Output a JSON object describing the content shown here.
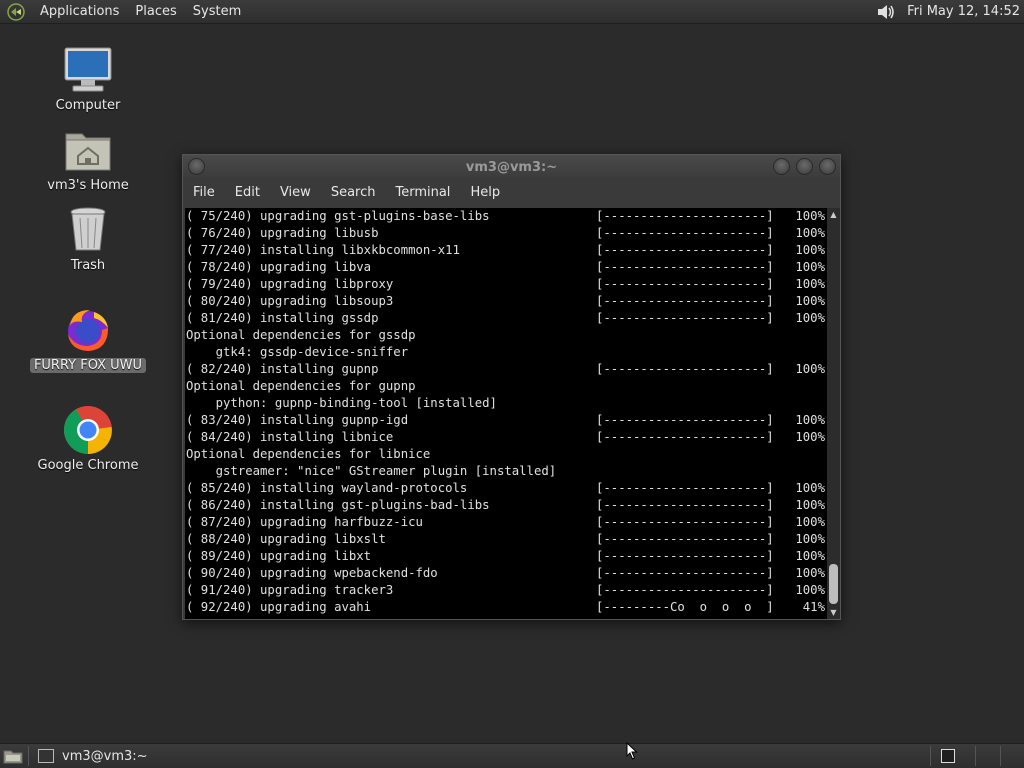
{
  "top_panel": {
    "menus": [
      "Applications",
      "Places",
      "System"
    ],
    "clock": "Fri May 12, 14:52",
    "volume_icon": "speaker-icon"
  },
  "desktop": {
    "icons": [
      {
        "label": "Computer",
        "icon": "computer-icon"
      },
      {
        "label": "vm3's Home",
        "icon": "home-folder-icon"
      },
      {
        "label": "Trash",
        "icon": "trash-icon"
      },
      {
        "label": "FURRY FOX UWU",
        "icon": "firefox-icon"
      },
      {
        "label": "Google Chrome",
        "icon": "chrome-icon"
      }
    ]
  },
  "terminal": {
    "title": "vm3@vm3:~",
    "menu": [
      "File",
      "Edit",
      "View",
      "Search",
      "Terminal",
      "Help"
    ],
    "lines": [
      {
        "text": "( 75/240) upgrading gst-plugins-base-libs",
        "bar": "[----------------------]",
        "pct": "100%"
      },
      {
        "text": "( 76/240) upgrading libusb",
        "bar": "[----------------------]",
        "pct": "100%"
      },
      {
        "text": "( 77/240) installing libxkbcommon-x11",
        "bar": "[----------------------]",
        "pct": "100%"
      },
      {
        "text": "( 78/240) upgrading libva",
        "bar": "[----------------------]",
        "pct": "100%"
      },
      {
        "text": "( 79/240) upgrading libproxy",
        "bar": "[----------------------]",
        "pct": "100%"
      },
      {
        "text": "( 80/240) upgrading libsoup3",
        "bar": "[----------------------]",
        "pct": "100%"
      },
      {
        "text": "( 81/240) installing gssdp",
        "bar": "[----------------------]",
        "pct": "100%"
      },
      {
        "text": "Optional dependencies for gssdp",
        "bar": "",
        "pct": ""
      },
      {
        "text": "    gtk4: gssdp-device-sniffer",
        "bar": "",
        "pct": ""
      },
      {
        "text": "( 82/240) installing gupnp",
        "bar": "[----------------------]",
        "pct": "100%"
      },
      {
        "text": "Optional dependencies for gupnp",
        "bar": "",
        "pct": ""
      },
      {
        "text": "    python: gupnp-binding-tool [installed]",
        "bar": "",
        "pct": ""
      },
      {
        "text": "( 83/240) installing gupnp-igd",
        "bar": "[----------------------]",
        "pct": "100%"
      },
      {
        "text": "( 84/240) installing libnice",
        "bar": "[----------------------]",
        "pct": "100%"
      },
      {
        "text": "Optional dependencies for libnice",
        "bar": "",
        "pct": ""
      },
      {
        "text": "    gstreamer: \"nice\" GStreamer plugin [installed]",
        "bar": "",
        "pct": ""
      },
      {
        "text": "( 85/240) installing wayland-protocols",
        "bar": "[----------------------]",
        "pct": "100%"
      },
      {
        "text": "( 86/240) installing gst-plugins-bad-libs",
        "bar": "[----------------------]",
        "pct": "100%"
      },
      {
        "text": "( 87/240) upgrading harfbuzz-icu",
        "bar": "[----------------------]",
        "pct": "100%"
      },
      {
        "text": "( 88/240) upgrading libxslt",
        "bar": "[----------------------]",
        "pct": "100%"
      },
      {
        "text": "( 89/240) upgrading libxt",
        "bar": "[----------------------]",
        "pct": "100%"
      },
      {
        "text": "( 90/240) upgrading wpebackend-fdo",
        "bar": "[----------------------]",
        "pct": "100%"
      },
      {
        "text": "( 91/240) upgrading tracker3",
        "bar": "[----------------------]",
        "pct": "100%"
      },
      {
        "text": "( 92/240) upgrading avahi",
        "bar": "[---------Co  o  o  o  ]",
        "pct": "41%"
      }
    ]
  },
  "bottom_panel": {
    "task_label": "vm3@vm3:~",
    "show_desktop_icon": "show-desktop-icon",
    "workspace_icon": "workspace-switcher-icon"
  }
}
